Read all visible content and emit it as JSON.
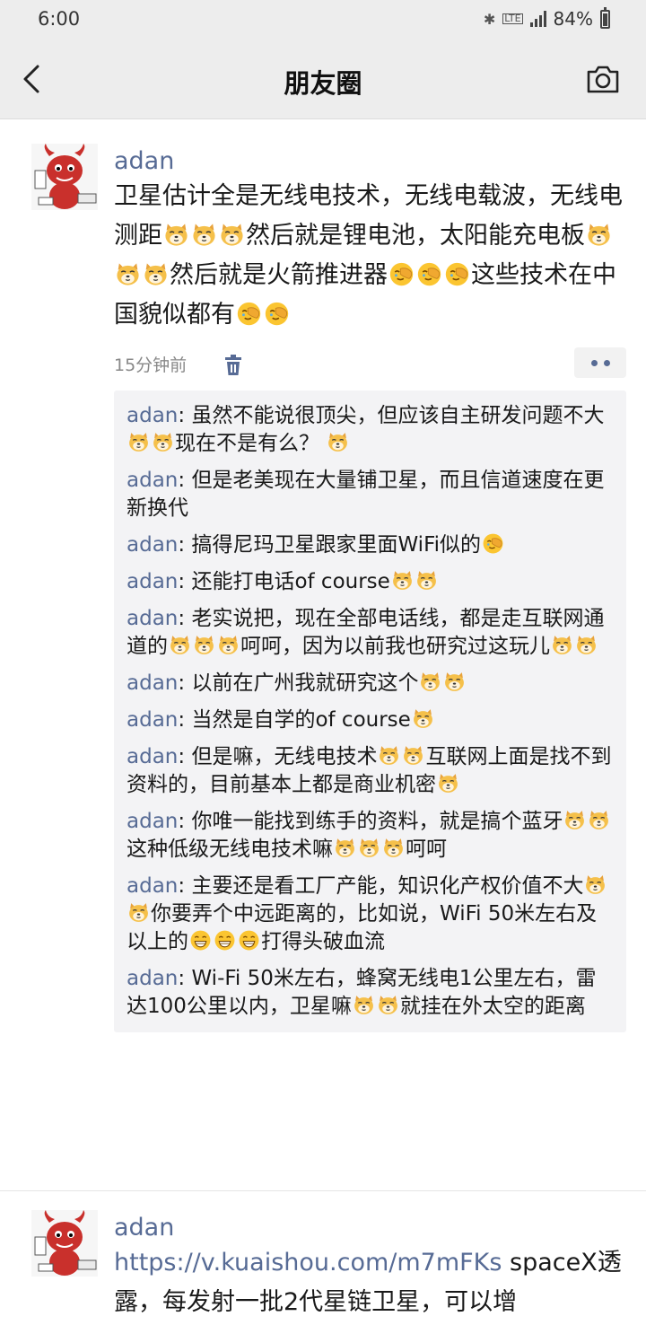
{
  "status_bar": {
    "time": "6:00",
    "battery": "84%",
    "icons": [
      "bluetooth-icon",
      "lte-icon",
      "signal-icon",
      "battery-icon"
    ]
  },
  "nav": {
    "title": "朋友圈",
    "back_icon": "chevron-left-icon",
    "camera_icon": "camera-icon"
  },
  "emojis": {
    "[旺柴]": "doge-face-icon",
    "[捂脸]": "facepalm-icon",
    "[呲牙]": "grin-icon"
  },
  "posts": [
    {
      "author": "adan",
      "text": "卫星估计全是无线电技术，无线电载波，无线电测距[旺柴][旺柴][旺柴]然后就是锂电池，太阳能充电板[旺柴][旺柴][旺柴]然后就是火箭推进器[捂脸][捂脸][捂脸]这些技术在中国貌似都有[捂脸][捂脸]",
      "time": "15分钟前",
      "comments": [
        {
          "name": "adan",
          "sep": ": ",
          "text": "虽然不能说很顶尖，但应该自主研发问题不大[旺柴][旺柴]现在不是有么？ [旺柴]"
        },
        {
          "name": "adan",
          "sep": ": ",
          "text": "但是老美现在大量铺卫星，而且信道速度在更新换代"
        },
        {
          "name": "adan",
          "sep": ": ",
          "text": "搞得尼玛卫星跟家里面WiFi似的[捂脸]"
        },
        {
          "name": "adan",
          "sep": ": ",
          "text": "还能打电话of course[旺柴][旺柴]"
        },
        {
          "name": "adan",
          "sep": ": ",
          "text": "老实说把，现在全部电话线，都是走互联网通道的[旺柴][旺柴][旺柴]呵呵，因为以前我也研究过这玩儿[旺柴][旺柴]"
        },
        {
          "name": "adan",
          "sep": ": ",
          "text": "以前在广州我就研究这个[旺柴][旺柴]"
        },
        {
          "name": "adan",
          "sep": ": ",
          "text": "当然是自学的of course[旺柴]"
        },
        {
          "name": "adan",
          "sep": ": ",
          "text": "但是嘛，无线电技术[旺柴][旺柴]互联网上面是找不到资料的，目前基本上都是商业机密[旺柴]"
        },
        {
          "name": "adan",
          "sep": ": ",
          "text": "你唯一能找到练手的资料，就是搞个蓝牙[旺柴][旺柴]这种低级无线电技术嘛[旺柴][旺柴][旺柴]呵呵"
        },
        {
          "name": "adan",
          "sep": ": ",
          "text": "主要还是看工厂产能，知识化产权价值不大[旺柴][旺柴]你要弄个中远距离的，比如说，WiFi 50米左右及以上的[呲牙][呲牙][呲牙]打得头破血流"
        },
        {
          "name": "adan",
          "sep": ": ",
          "text": "Wi-Fi 50米左右，蜂窝无线电1公里左右，雷达100公里以内，卫星嘛[旺柴][旺柴]就挂在外太空的距离"
        }
      ]
    },
    {
      "author": "adan",
      "link": "https://v.kuaishou.com/m7mFKs",
      "text": " spaceX透露，每发射一批2代星链卫星，可以增"
    }
  ]
}
